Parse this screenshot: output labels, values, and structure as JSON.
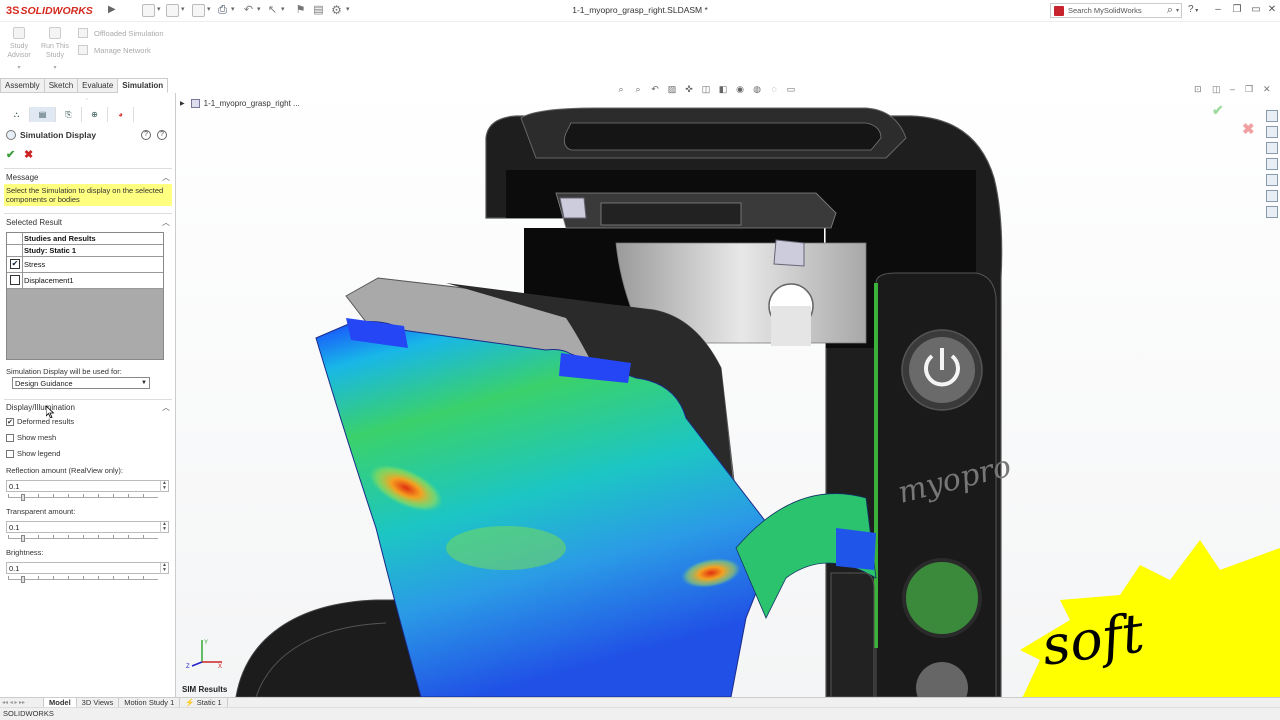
{
  "titlebar": {
    "brand_prefix": "3S",
    "brand_name": "SOLIDWORKS",
    "document_title": "1-1_myopro_grasp_right.SLDASM *",
    "search_placeholder": "Search MySolidWorks",
    "help_label": "?"
  },
  "command_manager": {
    "study_advisor": "Study Advisor",
    "run_this_study": "Run This Study",
    "offloaded_simulation": "Offloaded Simulation",
    "manage_network": "Manage Network"
  },
  "tabs": [
    "Assembly",
    "Sketch",
    "Evaluate",
    "Simulation"
  ],
  "property_manager": {
    "title": "Simulation Display",
    "message_section": "Message",
    "message_text": "Select the Simulation to display on the selected components or bodies",
    "selected_result_section": "Selected Result",
    "table_header": "Studies and Results",
    "study_row": "Study:  Static 1",
    "results": [
      {
        "label": "Stress",
        "checked": true
      },
      {
        "label": "Displacement1",
        "checked": false
      }
    ],
    "used_for_label": "Simulation Display will be used for:",
    "used_for_value": "Design Guidance",
    "display_section": "Display/Illumination",
    "deformed_results": "Deformed results",
    "show_mesh": "Show mesh",
    "show_legend": "Show legend",
    "reflection_label": "Reflection amount (RealView only):",
    "reflection_value": "0.1",
    "transparent_label": "Transparent amount:",
    "transparent_value": "0.1",
    "brightness_label": "Brightness:",
    "brightness_value": "0.1"
  },
  "viewport": {
    "tree_root": "1-1_myopro_grasp_right ...",
    "sim_results_label": "SIM Results",
    "device_logo": "myopro",
    "watermark": "soft"
  },
  "bottom_tabs": [
    "Model",
    "3D Views",
    "Motion Study 1",
    "Static 1"
  ],
  "status_text": "SOLIDWORKS",
  "colors": {
    "brand_red": "#d52b1e",
    "message_yellow": "#ffff80",
    "watermark_yellow": "#ffff00"
  }
}
